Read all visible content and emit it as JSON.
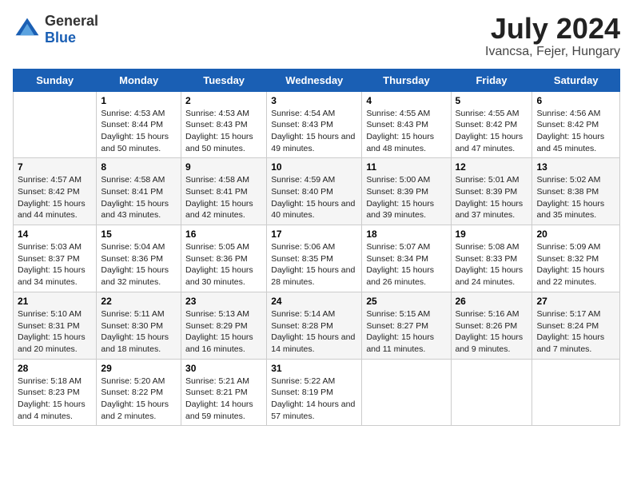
{
  "header": {
    "logo": {
      "general": "General",
      "blue": "Blue"
    },
    "title": "July 2024",
    "subtitle": "Ivancsa, Fejer, Hungary"
  },
  "columns": [
    "Sunday",
    "Monday",
    "Tuesday",
    "Wednesday",
    "Thursday",
    "Friday",
    "Saturday"
  ],
  "weeks": [
    [
      {
        "day": "",
        "sunrise": "",
        "sunset": "",
        "daylight": ""
      },
      {
        "day": "1",
        "sunrise": "Sunrise: 4:53 AM",
        "sunset": "Sunset: 8:44 PM",
        "daylight": "Daylight: 15 hours and 50 minutes."
      },
      {
        "day": "2",
        "sunrise": "Sunrise: 4:53 AM",
        "sunset": "Sunset: 8:43 PM",
        "daylight": "Daylight: 15 hours and 50 minutes."
      },
      {
        "day": "3",
        "sunrise": "Sunrise: 4:54 AM",
        "sunset": "Sunset: 8:43 PM",
        "daylight": "Daylight: 15 hours and 49 minutes."
      },
      {
        "day": "4",
        "sunrise": "Sunrise: 4:55 AM",
        "sunset": "Sunset: 8:43 PM",
        "daylight": "Daylight: 15 hours and 48 minutes."
      },
      {
        "day": "5",
        "sunrise": "Sunrise: 4:55 AM",
        "sunset": "Sunset: 8:42 PM",
        "daylight": "Daylight: 15 hours and 47 minutes."
      },
      {
        "day": "6",
        "sunrise": "Sunrise: 4:56 AM",
        "sunset": "Sunset: 8:42 PM",
        "daylight": "Daylight: 15 hours and 45 minutes."
      }
    ],
    [
      {
        "day": "7",
        "sunrise": "Sunrise: 4:57 AM",
        "sunset": "Sunset: 8:42 PM",
        "daylight": "Daylight: 15 hours and 44 minutes."
      },
      {
        "day": "8",
        "sunrise": "Sunrise: 4:58 AM",
        "sunset": "Sunset: 8:41 PM",
        "daylight": "Daylight: 15 hours and 43 minutes."
      },
      {
        "day": "9",
        "sunrise": "Sunrise: 4:58 AM",
        "sunset": "Sunset: 8:41 PM",
        "daylight": "Daylight: 15 hours and 42 minutes."
      },
      {
        "day": "10",
        "sunrise": "Sunrise: 4:59 AM",
        "sunset": "Sunset: 8:40 PM",
        "daylight": "Daylight: 15 hours and 40 minutes."
      },
      {
        "day": "11",
        "sunrise": "Sunrise: 5:00 AM",
        "sunset": "Sunset: 8:39 PM",
        "daylight": "Daylight: 15 hours and 39 minutes."
      },
      {
        "day": "12",
        "sunrise": "Sunrise: 5:01 AM",
        "sunset": "Sunset: 8:39 PM",
        "daylight": "Daylight: 15 hours and 37 minutes."
      },
      {
        "day": "13",
        "sunrise": "Sunrise: 5:02 AM",
        "sunset": "Sunset: 8:38 PM",
        "daylight": "Daylight: 15 hours and 35 minutes."
      }
    ],
    [
      {
        "day": "14",
        "sunrise": "Sunrise: 5:03 AM",
        "sunset": "Sunset: 8:37 PM",
        "daylight": "Daylight: 15 hours and 34 minutes."
      },
      {
        "day": "15",
        "sunrise": "Sunrise: 5:04 AM",
        "sunset": "Sunset: 8:36 PM",
        "daylight": "Daylight: 15 hours and 32 minutes."
      },
      {
        "day": "16",
        "sunrise": "Sunrise: 5:05 AM",
        "sunset": "Sunset: 8:36 PM",
        "daylight": "Daylight: 15 hours and 30 minutes."
      },
      {
        "day": "17",
        "sunrise": "Sunrise: 5:06 AM",
        "sunset": "Sunset: 8:35 PM",
        "daylight": "Daylight: 15 hours and 28 minutes."
      },
      {
        "day": "18",
        "sunrise": "Sunrise: 5:07 AM",
        "sunset": "Sunset: 8:34 PM",
        "daylight": "Daylight: 15 hours and 26 minutes."
      },
      {
        "day": "19",
        "sunrise": "Sunrise: 5:08 AM",
        "sunset": "Sunset: 8:33 PM",
        "daylight": "Daylight: 15 hours and 24 minutes."
      },
      {
        "day": "20",
        "sunrise": "Sunrise: 5:09 AM",
        "sunset": "Sunset: 8:32 PM",
        "daylight": "Daylight: 15 hours and 22 minutes."
      }
    ],
    [
      {
        "day": "21",
        "sunrise": "Sunrise: 5:10 AM",
        "sunset": "Sunset: 8:31 PM",
        "daylight": "Daylight: 15 hours and 20 minutes."
      },
      {
        "day": "22",
        "sunrise": "Sunrise: 5:11 AM",
        "sunset": "Sunset: 8:30 PM",
        "daylight": "Daylight: 15 hours and 18 minutes."
      },
      {
        "day": "23",
        "sunrise": "Sunrise: 5:13 AM",
        "sunset": "Sunset: 8:29 PM",
        "daylight": "Daylight: 15 hours and 16 minutes."
      },
      {
        "day": "24",
        "sunrise": "Sunrise: 5:14 AM",
        "sunset": "Sunset: 8:28 PM",
        "daylight": "Daylight: 15 hours and 14 minutes."
      },
      {
        "day": "25",
        "sunrise": "Sunrise: 5:15 AM",
        "sunset": "Sunset: 8:27 PM",
        "daylight": "Daylight: 15 hours and 11 minutes."
      },
      {
        "day": "26",
        "sunrise": "Sunrise: 5:16 AM",
        "sunset": "Sunset: 8:26 PM",
        "daylight": "Daylight: 15 hours and 9 minutes."
      },
      {
        "day": "27",
        "sunrise": "Sunrise: 5:17 AM",
        "sunset": "Sunset: 8:24 PM",
        "daylight": "Daylight: 15 hours and 7 minutes."
      }
    ],
    [
      {
        "day": "28",
        "sunrise": "Sunrise: 5:18 AM",
        "sunset": "Sunset: 8:23 PM",
        "daylight": "Daylight: 15 hours and 4 minutes."
      },
      {
        "day": "29",
        "sunrise": "Sunrise: 5:20 AM",
        "sunset": "Sunset: 8:22 PM",
        "daylight": "Daylight: 15 hours and 2 minutes."
      },
      {
        "day": "30",
        "sunrise": "Sunrise: 5:21 AM",
        "sunset": "Sunset: 8:21 PM",
        "daylight": "Daylight: 14 hours and 59 minutes."
      },
      {
        "day": "31",
        "sunrise": "Sunrise: 5:22 AM",
        "sunset": "Sunset: 8:19 PM",
        "daylight": "Daylight: 14 hours and 57 minutes."
      },
      {
        "day": "",
        "sunrise": "",
        "sunset": "",
        "daylight": ""
      },
      {
        "day": "",
        "sunrise": "",
        "sunset": "",
        "daylight": ""
      },
      {
        "day": "",
        "sunrise": "",
        "sunset": "",
        "daylight": ""
      }
    ]
  ]
}
